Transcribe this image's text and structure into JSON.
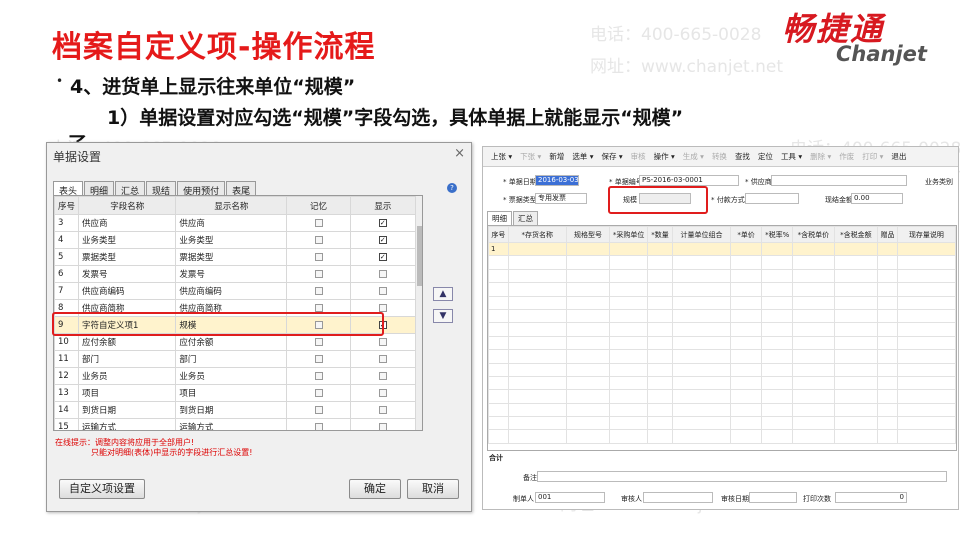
{
  "slide": {
    "title": "档案自定义项-操作流程",
    "logo_cn": "畅捷通",
    "logo_en": "Chanjet",
    "bullet": "•",
    "heading_line1": "4、进货单上显示往来单位“规模”",
    "heading_line2": "1）单据设置对应勾选“规模”字段勾选，具体单据上就能显示“规模”",
    "heading_line3": "了",
    "watermark_phone": "电话：400-665-0028",
    "watermark_site": "网址：www.chanjet.net"
  },
  "dialog": {
    "title": "单据设置",
    "close": "×",
    "help": "?",
    "tabs": [
      "表头",
      "明细",
      "汇总",
      "现结",
      "使用预付",
      "表尾"
    ],
    "columns": [
      "序号",
      "字段名称",
      "显示名称",
      "记忆",
      "显示"
    ],
    "rows": [
      {
        "no": "3",
        "field": "供应商",
        "display": "供应商",
        "memory": false,
        "show": true
      },
      {
        "no": "4",
        "field": "业务类型",
        "display": "业务类型",
        "memory": false,
        "show": true
      },
      {
        "no": "5",
        "field": "票据类型",
        "display": "票据类型",
        "memory": false,
        "show": true
      },
      {
        "no": "6",
        "field": "发票号",
        "display": "发票号",
        "memory": false,
        "show": false
      },
      {
        "no": "7",
        "field": "供应商编码",
        "display": "供应商编码",
        "memory": false,
        "show": false
      },
      {
        "no": "8",
        "field": "供应商简称",
        "display": "供应商简称",
        "memory": false,
        "show": false
      },
      {
        "no": "9",
        "field": "字符自定义项1",
        "display": "规模",
        "memory": false,
        "show": true
      },
      {
        "no": "10",
        "field": "应付余额",
        "display": "应付余额",
        "memory": false,
        "show": false
      },
      {
        "no": "11",
        "field": "部门",
        "display": "部门",
        "memory": false,
        "show": false
      },
      {
        "no": "12",
        "field": "业务员",
        "display": "业务员",
        "memory": false,
        "show": false
      },
      {
        "no": "13",
        "field": "项目",
        "display": "项目",
        "memory": false,
        "show": false
      },
      {
        "no": "14",
        "field": "到货日期",
        "display": "到货日期",
        "memory": false,
        "show": false
      },
      {
        "no": "15",
        "field": "运输方式",
        "display": "运输方式",
        "memory": false,
        "show": false
      }
    ],
    "up": "▲",
    "down": "▼",
    "tip_line1": "在线提示：调整内容将应用于全部用户!",
    "tip_line2": "只能对明细(表体)中显示的字段进行汇总设置!",
    "custom_button": "自定义项设置",
    "ok_button": "确定",
    "cancel_button": "取消"
  },
  "form": {
    "toolbar": [
      {
        "label": "上张 ▾",
        "dim": false
      },
      {
        "label": "下张 ▾",
        "dim": true
      },
      {
        "label": "新增",
        "dim": false
      },
      {
        "label": "选单 ▾",
        "dim": false
      },
      {
        "label": "保存 ▾",
        "dim": false
      },
      {
        "label": "审核",
        "dim": true
      },
      {
        "label": "操作 ▾",
        "dim": false
      },
      {
        "label": "生成 ▾",
        "dim": true
      },
      {
        "label": "转换",
        "dim": true
      },
      {
        "label": "查找",
        "dim": false
      },
      {
        "label": "定位",
        "dim": false
      },
      {
        "label": "工具 ▾",
        "dim": false
      },
      {
        "label": "删除 ▾",
        "dim": true
      },
      {
        "label": "作废",
        "dim": true
      },
      {
        "label": "打印 ▾",
        "dim": true
      },
      {
        "label": "退出",
        "dim": false
      }
    ],
    "date_label": "* 单据日期",
    "date_value": "2016-03-03",
    "no_label": "* 单据编号",
    "no_value": "PS-2016-03-0001",
    "supplier_label": "* 供应商",
    "biztype_label": "业务类别",
    "invtype_label": "* 票据类型",
    "invtype_value": "专用发票",
    "scale_label": "规模",
    "pay_label": "* 付款方式",
    "cash_label": "现结金额",
    "cash_value": "0.00",
    "tabs": [
      "明细",
      "汇总"
    ],
    "columns": [
      "序号",
      "*存货名称",
      "规格型号",
      "*采购单位",
      "*数量",
      "计量单位组合",
      "*单价",
      "*税率%",
      "*含税单价",
      "*含税金额",
      "赠品",
      "现存量说明"
    ],
    "first_row": "1",
    "total_label": "合计",
    "remark_label": "备注",
    "maker_label": "制单人",
    "maker_value": "001",
    "auditor_label": "审核人",
    "audit_date_label": "审核日期",
    "print_count_label": "打印次数",
    "print_count_value": "0"
  }
}
